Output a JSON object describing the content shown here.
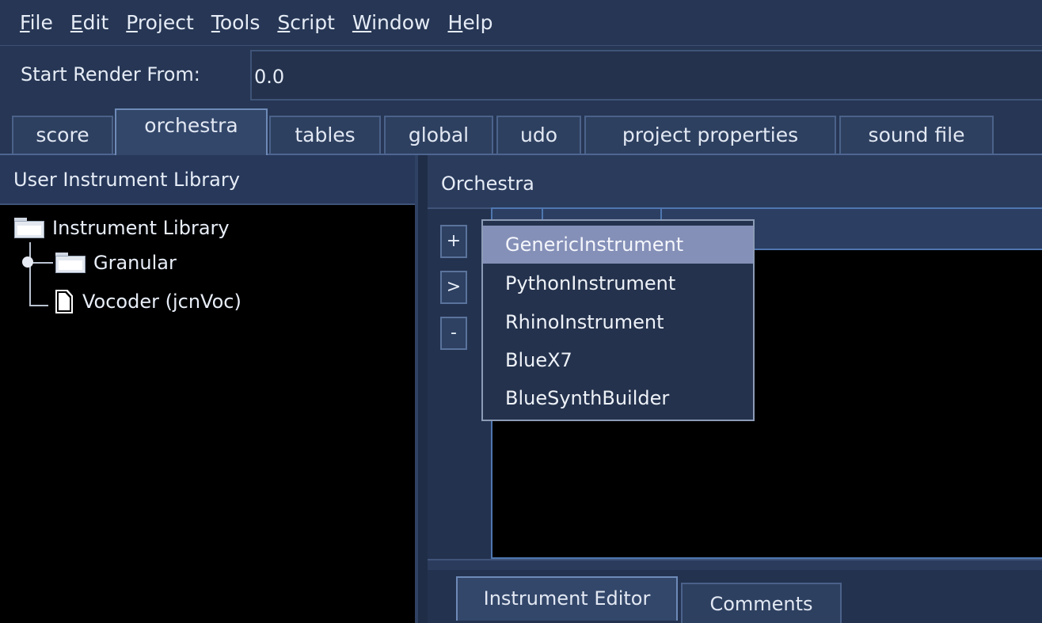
{
  "menubar": {
    "items": [
      {
        "mnemonic": "F",
        "rest": "ile"
      },
      {
        "mnemonic": "E",
        "rest": "dit"
      },
      {
        "mnemonic": "P",
        "rest": "roject"
      },
      {
        "mnemonic": "T",
        "rest": "ools"
      },
      {
        "mnemonic": "S",
        "rest": "cript"
      },
      {
        "mnemonic": "W",
        "rest": "indow"
      },
      {
        "mnemonic": "H",
        "rest": "elp"
      }
    ]
  },
  "render": {
    "label": "Start Render From:",
    "value": "0.0"
  },
  "tabs": [
    {
      "label": "score"
    },
    {
      "label": "orchestra",
      "active": true
    },
    {
      "label": "tables"
    },
    {
      "label": "global"
    },
    {
      "label": "udo"
    },
    {
      "label": "project properties"
    },
    {
      "label": "sound file"
    }
  ],
  "library": {
    "title": "User Instrument Library",
    "root": "Instrument Library",
    "children": [
      {
        "label": "Granular",
        "icon": "folder-icon"
      },
      {
        "label": "Vocoder (jcnVoc)",
        "icon": "document-icon"
      }
    ]
  },
  "orchestra": {
    "title": "Orchestra",
    "buttons": {
      "add": "+",
      "import": ">",
      "remove": "-"
    }
  },
  "add_menu": {
    "items": [
      {
        "label": "GenericInstrument",
        "selected": true
      },
      {
        "label": "PythonInstrument"
      },
      {
        "label": "RhinoInstrument"
      },
      {
        "label": "BlueX7"
      },
      {
        "label": "BlueSynthBuilder"
      }
    ]
  },
  "editor_tabs": [
    {
      "label": "Instrument Editor",
      "active": true
    },
    {
      "label": "Comments"
    }
  ],
  "colors": {
    "background": "#1f2d47",
    "selection": "#8590b8",
    "accent_border": "#4f76b0"
  }
}
